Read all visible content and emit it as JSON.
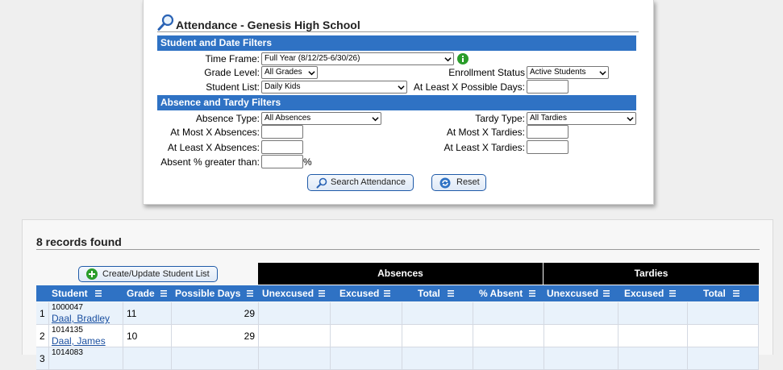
{
  "filters": {
    "title": "Attendance - Genesis High School",
    "section1": "Student and Date Filters",
    "section2": "Absence and Tardy Filters",
    "time_frame": {
      "label": "Time Frame:",
      "value": "Full Year (8/12/25-6/30/26)"
    },
    "grade_level": {
      "label": "Grade Level:",
      "value": "All Grades"
    },
    "enrollment_status": {
      "label": "Enrollment Status",
      "value": "Active Students"
    },
    "student_list": {
      "label": "Student List:",
      "value": "Daily Kids"
    },
    "possible_days": {
      "label": "At Least X Possible Days:",
      "value": ""
    },
    "absence_type": {
      "label": "Absence Type:",
      "value": "All Absences"
    },
    "tardy_type": {
      "label": "Tardy Type:",
      "value": "All Tardies"
    },
    "at_most_absences": {
      "label": "At Most X Absences:",
      "value": ""
    },
    "at_most_tardies": {
      "label": "At Most X Tardies:",
      "value": ""
    },
    "at_least_absences": {
      "label": "At Least X Absences:",
      "value": ""
    },
    "at_least_tardies": {
      "label": "At Least X Tardies:",
      "value": ""
    },
    "absent_pct": {
      "label": "Absent % greater than:",
      "value": "",
      "suffix": "%"
    },
    "search_button": "Search Attendance",
    "reset_button": "Reset"
  },
  "results": {
    "count_text": "8 records found",
    "create_button": "Create/Update Student List",
    "group_absences": "Absences",
    "group_tardies": "Tardies",
    "columns": [
      "Student",
      "Grade",
      "Possible Days",
      "Unexcused",
      "Excused",
      "Total",
      "% Absent",
      "Unexcused",
      "Excused",
      "Total"
    ],
    "rows": [
      {
        "num": "1",
        "id": "1000047",
        "name": "Daal, Bradley",
        "grade": "11",
        "days": "29"
      },
      {
        "num": "2",
        "id": "1014135",
        "name": "Daal, James",
        "grade": "10",
        "days": "29"
      },
      {
        "num": "3",
        "id": "1014083",
        "name": "",
        "grade": "",
        "days": ""
      }
    ]
  },
  "colors": {
    "header_blue": "#2f72c4",
    "row_alt": "#e9f2fb",
    "link": "#1a4fa0"
  }
}
